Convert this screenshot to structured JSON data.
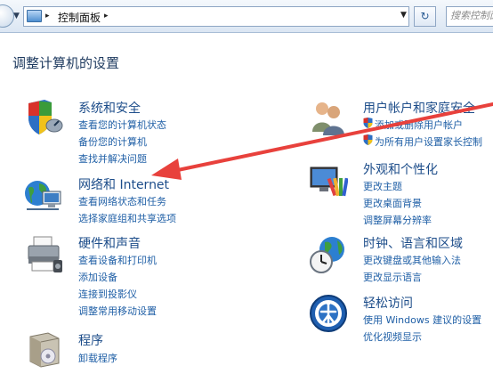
{
  "address_bar": {
    "breadcrumb": "控制面板",
    "separator": "▸",
    "search_placeholder": "搜索控制面"
  },
  "page_title": "调整计算机的设置",
  "left_column": [
    {
      "name": "系统和安全",
      "icon": "security-shield-icon",
      "links": [
        "查看您的计算机状态",
        "备份您的计算机",
        "查找并解决问题"
      ]
    },
    {
      "name": "网络和 Internet",
      "icon": "network-globe-icon",
      "links": [
        "查看网络状态和任务",
        "选择家庭组和共享选项"
      ]
    },
    {
      "name": "硬件和声音",
      "icon": "printer-icon",
      "links": [
        "查看设备和打印机",
        "添加设备",
        "连接到投影仪",
        "调整常用移动设置"
      ]
    },
    {
      "name": "程序",
      "icon": "programs-box-icon",
      "links": [
        "卸载程序"
      ]
    }
  ],
  "right_column": [
    {
      "name": "用户帐户和家庭安全",
      "icon": "users-icon",
      "links": [
        "添加或删除用户帐户",
        "为所有用户设置家长控制"
      ]
    },
    {
      "name": "外观和个性化",
      "icon": "monitor-palette-icon",
      "links": [
        "更改主题",
        "更改桌面背景",
        "调整屏幕分辨率"
      ]
    },
    {
      "name": "时钟、语言和区域",
      "icon": "clock-globe-icon",
      "links": [
        "更改键盘或其他输入法",
        "更改显示语言"
      ]
    },
    {
      "name": "轻松访问",
      "icon": "ease-of-access-icon",
      "links": [
        "使用 Windows 建议的设置",
        "优化视频显示"
      ]
    }
  ],
  "colors": {
    "heading": "#1d4d8a",
    "link": "#1f5fa6",
    "annotation_arrow": "#e8413c"
  }
}
